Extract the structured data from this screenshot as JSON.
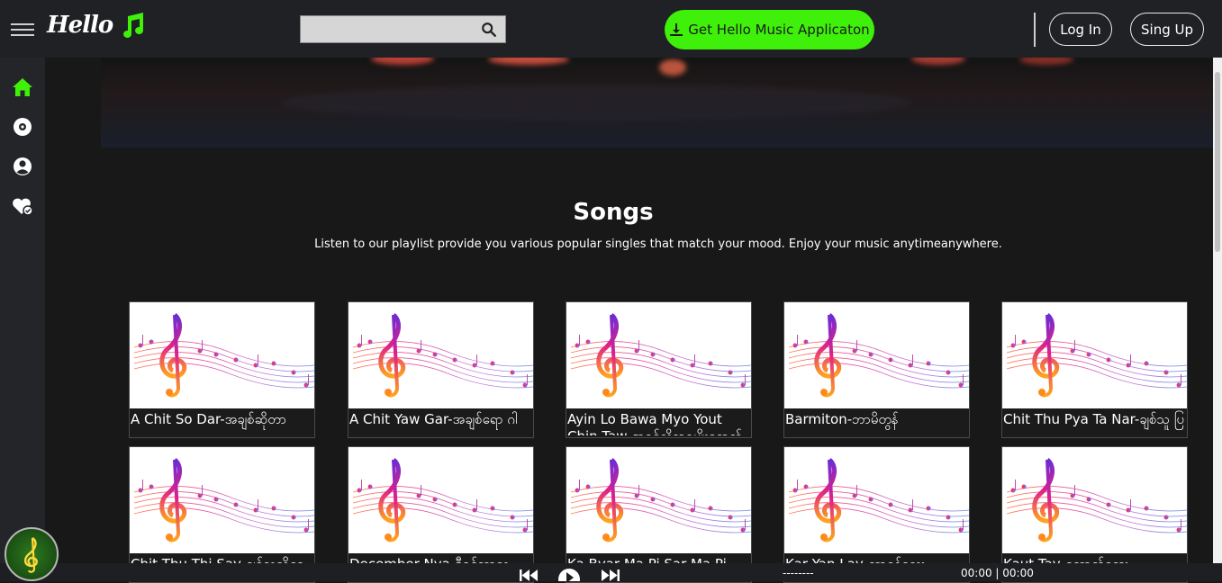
{
  "app": {
    "logo_text": "Hello"
  },
  "header": {
    "search": {
      "value": "",
      "placeholder": ""
    },
    "get_app_label": "Get Hello Music Applicaton",
    "login_label": "Log In",
    "signup_label": "Sing Up"
  },
  "sidebar": {
    "items": [
      {
        "name": "home",
        "icon": "home-icon",
        "active": true
      },
      {
        "name": "albums",
        "icon": "disc-icon",
        "active": false
      },
      {
        "name": "artists",
        "icon": "user-icon",
        "active": false
      },
      {
        "name": "favorites",
        "icon": "heart-check-icon",
        "active": false
      }
    ]
  },
  "songs_section": {
    "title": "Songs",
    "subtitle": "Listen to our playlist provide you various popular singles that match your mood. Enjoy your music anytimeanywhere."
  },
  "songs": [
    {
      "title": "A Chit So Dar-အချစ်ဆိုတာ"
    },
    {
      "title": "A Chit Yaw Gar-အချစ်ရော ဂါ"
    },
    {
      "title": "Ayin Lo Bawa Myo Yout Chin Taw-အရင်လိုဘဝမျိုးရောက်ချင်တော့"
    },
    {
      "title": "Barmiton-ဘာမိတွန်"
    },
    {
      "title": "Chit Thu Pya Ta Nar-ချစ်သူ ပြ"
    },
    {
      "title": "Chit Thu Thi Say-ချစ်သူသိစေ"
    },
    {
      "title": "December Nya-ဒီဇင်ဘာည"
    },
    {
      "title": "Ka Byar Ma Pi Sar Ma Pi"
    },
    {
      "title": "Kar Yan Lay-ကာရန်လေး"
    },
    {
      "title": "Kaut Tay-ကောက်တေး"
    }
  ],
  "player": {
    "song_name": "--------",
    "time_display": "00:00 | 00:00"
  },
  "colors": {
    "accent": "#3ef00a",
    "topbar": "#1f2124",
    "sidebar": "#232529",
    "background": "#181818"
  }
}
